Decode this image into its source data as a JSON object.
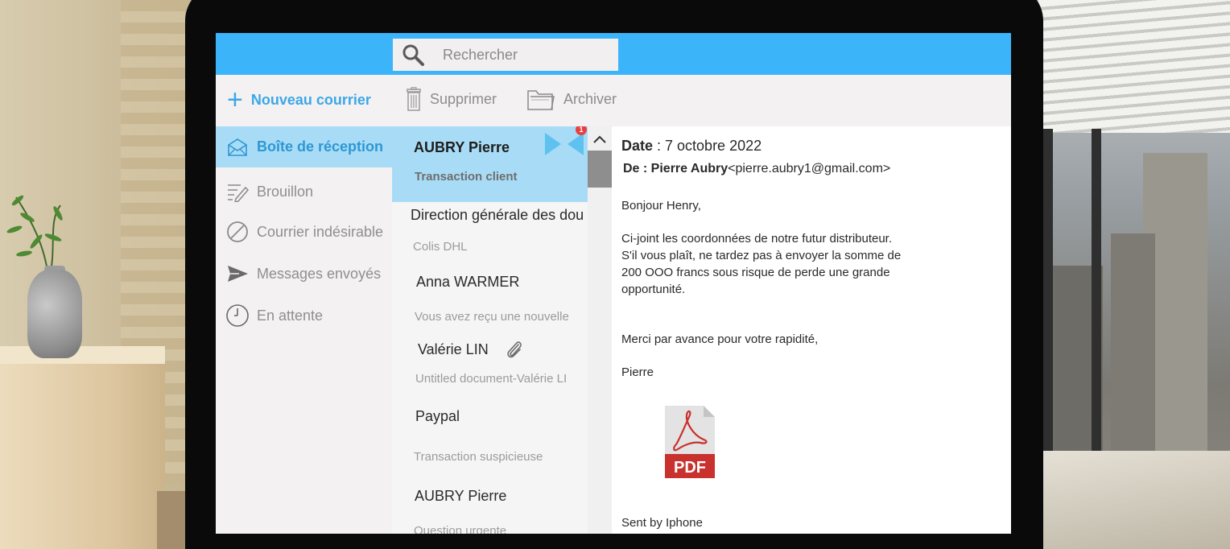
{
  "search": {
    "placeholder": "Rechercher"
  },
  "toolbar": {
    "new_mail": "Nouveau courrier",
    "delete": "Supprimer",
    "archive": "Archiver"
  },
  "sidebar": {
    "items": [
      {
        "label": "Boîte de réception",
        "icon": "inbox-icon",
        "active": true
      },
      {
        "label": "Brouillon",
        "icon": "draft-icon"
      },
      {
        "label": "Courrier indésirable",
        "icon": "junk-icon"
      },
      {
        "label": "Messages envoyés",
        "icon": "send-icon"
      },
      {
        "label": "En attente",
        "icon": "clock-icon"
      }
    ]
  },
  "messages": [
    {
      "sender": "AUBRY Pierre",
      "subject": "Transaction client",
      "unread_count": "1",
      "selected": true
    },
    {
      "sender": "Direction générale des dou",
      "subject": "Colis DHL"
    },
    {
      "sender": "Anna WARMER",
      "subject": "Vous avez reçu une nouvelle"
    },
    {
      "sender": "Valérie LIN",
      "subject": "Untitled document-Valérie LI",
      "has_attachment": true
    },
    {
      "sender": "Paypal",
      "subject": "Transaction suspicieuse"
    },
    {
      "sender": "AUBRY Pierre",
      "subject": "Question urgente"
    }
  ],
  "email": {
    "date_label": "Date",
    "date_value": " : 7 octobre 2022",
    "from_label": "De : Pierre Aubry",
    "from_email": "<pierre.aubry1@gmail.com>",
    "greeting": "Bonjour Henry,",
    "body": [
      "Ci-joint les coordonnées de notre futur distributeur.",
      "S'il vous plaît, ne tardez pas à envoyer la somme de",
      "200 OOO francs sous risque de perde une grande",
      "opportunité."
    ],
    "closing": "Merci par avance pour votre rapidité,",
    "signature": "Pierre",
    "attachment_type": "PDF",
    "footer": "Sent by Iphone"
  },
  "colors": {
    "topbar": "#3bb4f9",
    "selection": "#a8dcf6",
    "accent": "#3ba7e8",
    "pdf_red": "#c8312e"
  }
}
